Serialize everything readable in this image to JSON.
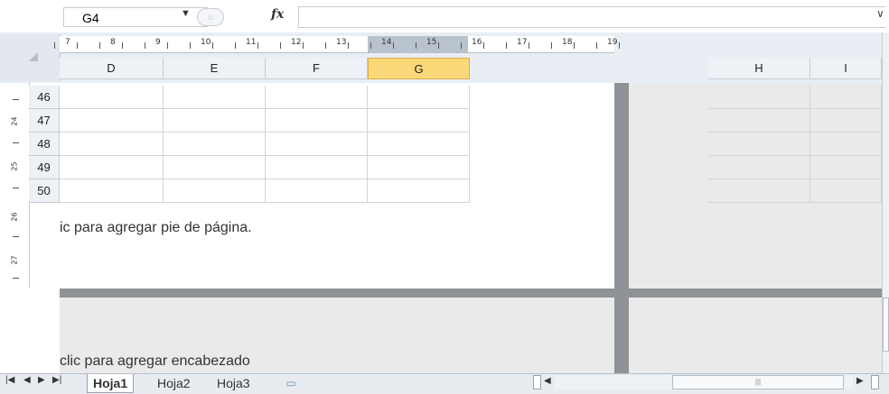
{
  "formula_bar": {
    "name_box": "G4",
    "fx_label": "fx",
    "formula_value": ""
  },
  "ruler": {
    "numbers": [
      "7",
      "8",
      "9",
      "10",
      "11",
      "12",
      "13",
      "14",
      "15",
      "16",
      "17",
      "18",
      "19"
    ]
  },
  "columns": {
    "page": [
      "D",
      "E",
      "F",
      "G"
    ],
    "right": [
      "H",
      "I"
    ],
    "selected": "G"
  },
  "rows": [
    "46",
    "47",
    "48",
    "49",
    "50"
  ],
  "vertical_ruler": [
    "24",
    "25",
    "26",
    "27"
  ],
  "page": {
    "footer_hint": "ic para agregar pie de página.",
    "header_hint": "clic para agregar encabezado"
  },
  "sheet_tabs": {
    "tabs": [
      "Hoja1",
      "Hoja2",
      "Hoja3"
    ],
    "active": "Hoja1"
  },
  "colors": {
    "selected_column": "#fbd97a",
    "page_gap": "#8f9296"
  }
}
